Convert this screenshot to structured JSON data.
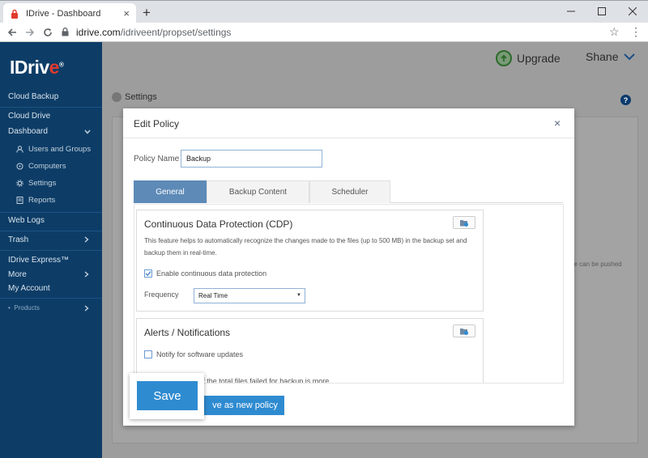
{
  "browser": {
    "tab_title": "IDrive - Dashboard",
    "tab_close": "×",
    "new_tab": "+",
    "url_host": "idrive.com",
    "url_path": "/idriveent/propset/settings"
  },
  "sidebar": {
    "logo_prefix": "IDriv",
    "logo_e": "e",
    "logo_mark": "®",
    "items": [
      {
        "label": "Cloud Backup"
      },
      {
        "label": "Cloud Drive"
      },
      {
        "label": "Dashboard"
      },
      {
        "label": "Web Logs"
      },
      {
        "label": "Trash"
      },
      {
        "label": "IDrive Express™"
      },
      {
        "label": "More"
      },
      {
        "label": "My Account"
      },
      {
        "label": "Products"
      }
    ],
    "sub_items": [
      {
        "label": "Users and Groups"
      },
      {
        "label": "Computers"
      },
      {
        "label": "Settings"
      },
      {
        "label": "Reports"
      }
    ]
  },
  "header": {
    "upgrade_label": "Upgrade",
    "user_name": "Shane",
    "breadcrumb": "Settings",
    "help": "?"
  },
  "background": {
    "partial_text": "ne can be pushed"
  },
  "modal": {
    "title": "Edit Policy",
    "close": "×",
    "policy_name_label": "Policy Name",
    "policy_name_value": "Backup",
    "tabs": [
      {
        "label": "General",
        "active": true
      },
      {
        "label": "Backup Content",
        "active": false
      },
      {
        "label": "Scheduler",
        "active": false
      }
    ],
    "cdp": {
      "title": "Continuous Data Protection (CDP)",
      "description": "This feature helps to automatically recognize the changes made to the files (up to 500 MB) in the backup set and backup them in real-time.",
      "checkbox_label": "Enable continuous data protection",
      "checked": true,
      "frequency_label": "Frequency",
      "frequency_value": "Real Time"
    },
    "alerts": {
      "title": "Alerts / Notifications",
      "checkbox_label": "Notify for software updates",
      "checked": false,
      "partial_text": "ure' if the total files failed for backup is more"
    },
    "save_label": "Save",
    "save_new_partial": "ve as new policy"
  },
  "colors": {
    "sidebar_bg": "#0d3d67",
    "accent": "#2f8bd0",
    "active_tab": "#5d8ab7"
  }
}
